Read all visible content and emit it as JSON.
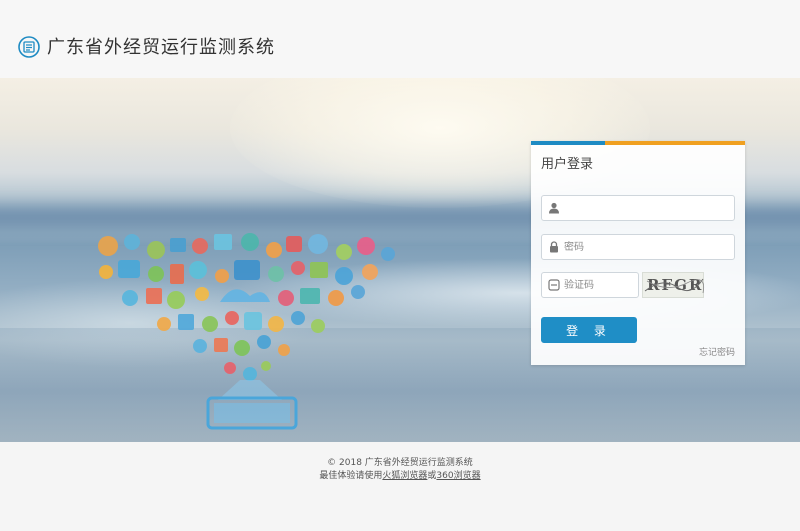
{
  "header": {
    "title": "广东省外经贸运行监测系统",
    "logo_icon": "document-list-icon"
  },
  "login": {
    "title": "用户登录",
    "username": {
      "value": "",
      "placeholder": "",
      "icon": "user-icon"
    },
    "password": {
      "value": "",
      "placeholder": "密码",
      "icon": "lock-icon"
    },
    "captcha": {
      "value": "",
      "placeholder": "验证码",
      "icon": "captcha-icon",
      "image_text": "RFGR"
    },
    "submit_label": "登 录",
    "forgot_label": "忘记密码"
  },
  "footer": {
    "copyright": "© 2018 广东省外经贸运行监测系统",
    "browser_prefix": "最佳体验请使用",
    "firefox": "火狐浏览器",
    "or": "或",
    "browser360": "360浏览器"
  },
  "colors": {
    "accent_blue": "#1e8bc3",
    "accent_orange": "#f0a020",
    "button": "#1f8ec6"
  }
}
